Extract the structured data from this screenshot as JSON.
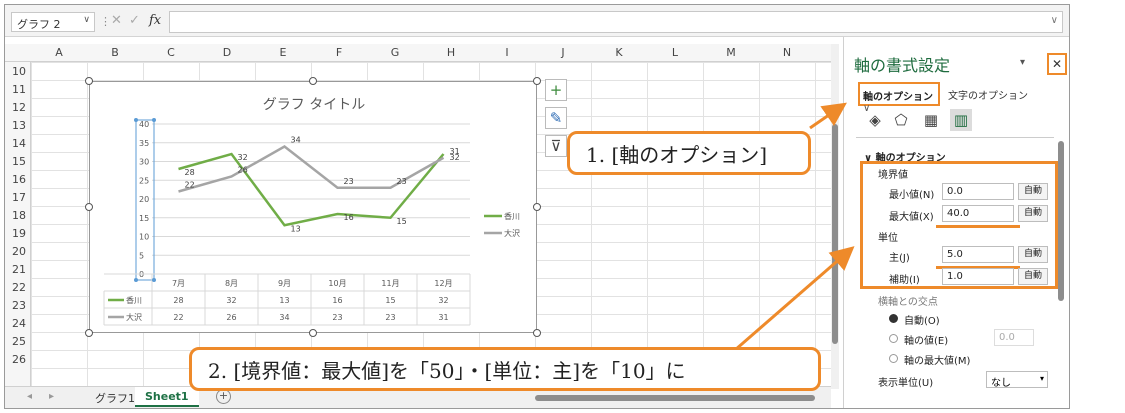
{
  "name_box": "グラフ 2",
  "formula_bar": {
    "cancel_icon": "✕",
    "enter_icon": "✓",
    "fx_label": "fx",
    "value": ""
  },
  "columns": [
    "A",
    "B",
    "C",
    "D",
    "E",
    "F",
    "G",
    "H",
    "I",
    "J",
    "K",
    "L",
    "M",
    "N"
  ],
  "rows": [
    "10",
    "11",
    "12",
    "13",
    "14",
    "15",
    "16",
    "17",
    "18",
    "19",
    "20",
    "21",
    "22",
    "23",
    "24",
    "25",
    "26"
  ],
  "sheet_tabs": {
    "tabs": [
      "グラフ1",
      "Sheet1"
    ],
    "active": "Sheet1"
  },
  "chart_data": {
    "type": "line",
    "title": "グラフ タイトル",
    "categories": [
      "7月",
      "8月",
      "9月",
      "10月",
      "11月",
      "12月"
    ],
    "series": [
      {
        "name": "香川",
        "color": "#70ad47",
        "values": [
          28,
          32,
          13,
          16,
          15,
          32
        ]
      },
      {
        "name": "大沢",
        "color": "#a5a5a5",
        "values": [
          22,
          26,
          34,
          23,
          23,
          31
        ]
      }
    ],
    "y_ticks": [
      "0",
      "5",
      "10",
      "15",
      "20",
      "25",
      "30",
      "35",
      "40"
    ],
    "ylim": [
      0,
      40
    ],
    "grid": true,
    "legend": "right",
    "data_table": true
  },
  "chart_buttons": {
    "add": "plus-icon",
    "style": "brush-icon",
    "filter": "filter-icon"
  },
  "pane": {
    "title": "軸の書式設定",
    "collapse_arrow": "▾",
    "close": "✕",
    "tab_axis": "軸のオプション",
    "tab_axis_arrow": "∨",
    "tab_text": "文字のオプション",
    "section": "軸のオプション",
    "bounds_label": "境界値",
    "min_label": "最小値(N)",
    "min_value": "0.0",
    "max_label": "最大値(X)",
    "max_value": "40.0",
    "units_label": "単位",
    "major_label": "主(J)",
    "major_value": "5.0",
    "minor_label": "補助(I)",
    "minor_value": "1.0",
    "auto": "自動",
    "cross_label": "横軸との交点",
    "cross_auto": "自動(O)",
    "cross_value": "軸の値(E)",
    "cross_value_input": "0.0",
    "cross_max": "軸の最大値(M)",
    "display_units_label": "表示単位(U)",
    "display_units_value": "なし"
  },
  "callouts": {
    "c1": "1. [軸のオプション]",
    "c2": "2. [境界値：最大値]を「50」・[単位：主]を「10」に"
  }
}
